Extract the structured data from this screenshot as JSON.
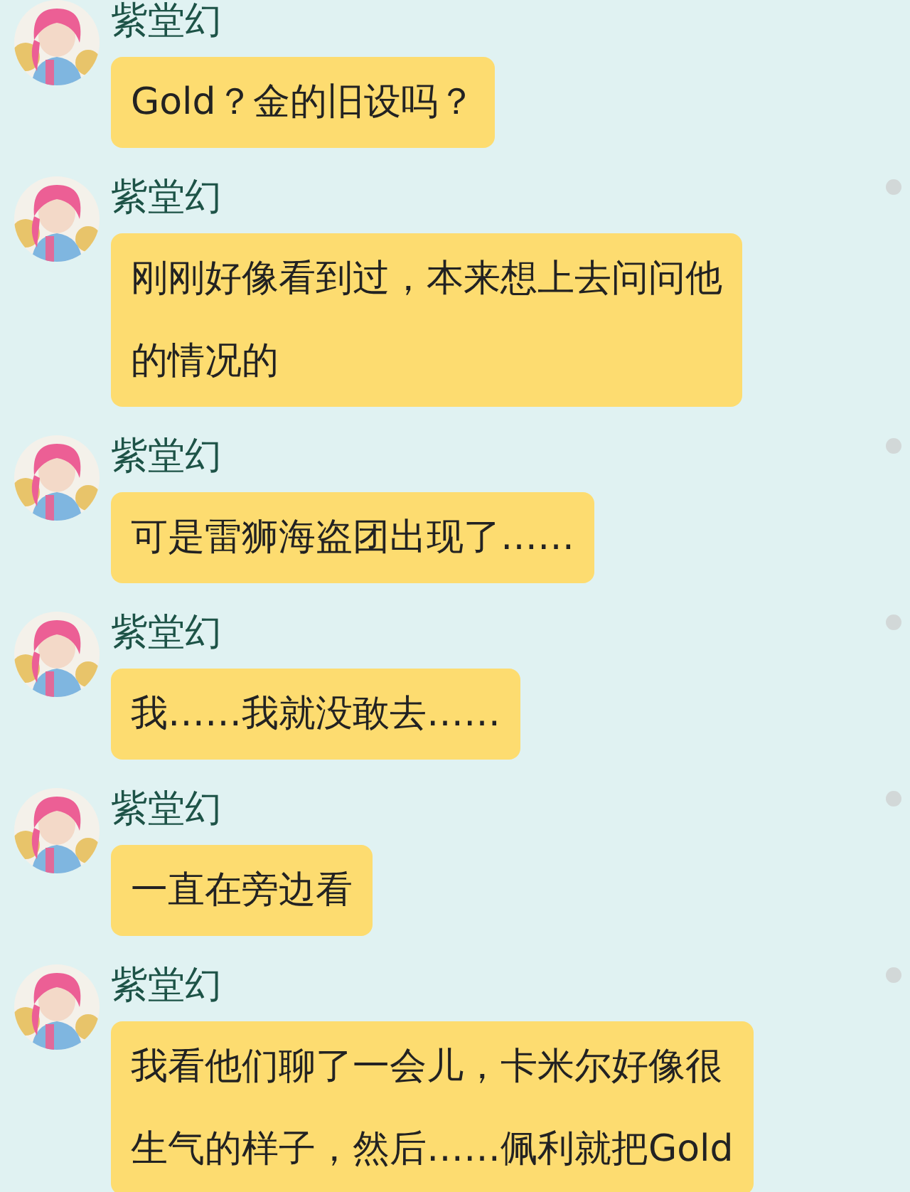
{
  "messages": [
    {
      "sender": "紫堂幻",
      "lines": [
        "Gold？金的旧设吗？"
      ],
      "dot": false
    },
    {
      "sender": "紫堂幻",
      "lines": [
        "刚刚好像看到过，本来想上去问问他",
        "的情况的"
      ],
      "dot": true
    },
    {
      "sender": "紫堂幻",
      "lines": [
        "可是雷狮海盗团出现了……"
      ],
      "dot": true
    },
    {
      "sender": "紫堂幻",
      "lines": [
        "我……我就没敢去……"
      ],
      "dot": true
    },
    {
      "sender": "紫堂幻",
      "lines": [
        "一直在旁边看"
      ],
      "dot": true
    },
    {
      "sender": "紫堂幻",
      "lines": [
        "我看他们聊了一会儿，卡米尔好像很",
        "生气的样子，然后……佩利就把Gold"
      ],
      "dot": true
    }
  ]
}
